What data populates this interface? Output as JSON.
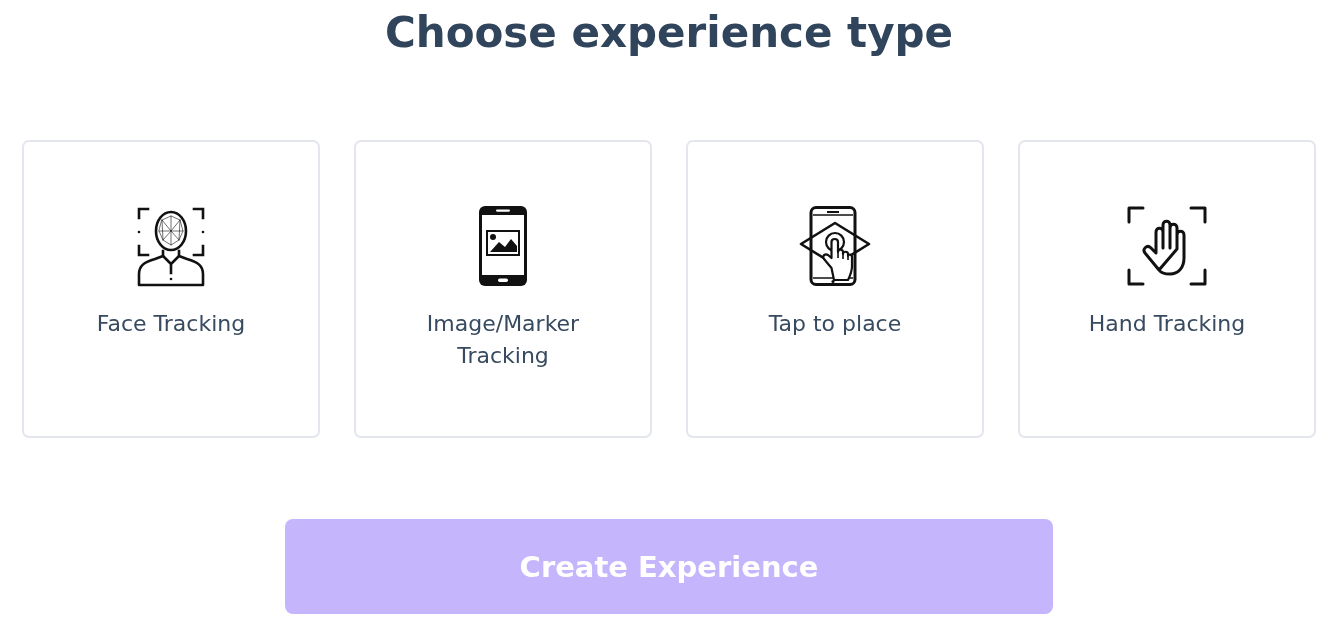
{
  "title": "Choose experience type",
  "cards": [
    {
      "label": "Face Tracking",
      "selected": false
    },
    {
      "label": "Image/Marker Tracking",
      "selected": false
    },
    {
      "label": "Tap to place",
      "selected": false
    },
    {
      "label": "Hand Tracking",
      "selected": false
    }
  ],
  "create_button": {
    "label": "Create Experience",
    "disabled": true
  }
}
